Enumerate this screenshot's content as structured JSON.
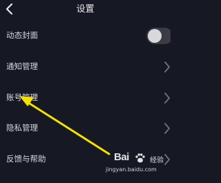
{
  "header": {
    "title": "设置"
  },
  "settings": {
    "items": [
      {
        "label": "动态封面",
        "control": "toggle",
        "toggle_on": false
      },
      {
        "label": "通知管理",
        "control": "chevron"
      },
      {
        "label": "账号管理",
        "control": "chevron"
      },
      {
        "label": "隐私管理",
        "control": "chevron"
      },
      {
        "label": "反馈与帮助",
        "control": "chevron"
      }
    ]
  },
  "annotation": {
    "arrow_color": "#f5e100"
  },
  "watermark": {
    "brand": "Bai",
    "suffix": "经验",
    "url": "jingyan.baidu.com"
  },
  "colors": {
    "background": "#161823",
    "text": "#d6d7db",
    "toggle_track": "#3a3b44"
  },
  "icons": {
    "back": "chevron-left-icon",
    "row_arrow": "chevron-right-icon",
    "watermark_logo": "paw-icon"
  }
}
